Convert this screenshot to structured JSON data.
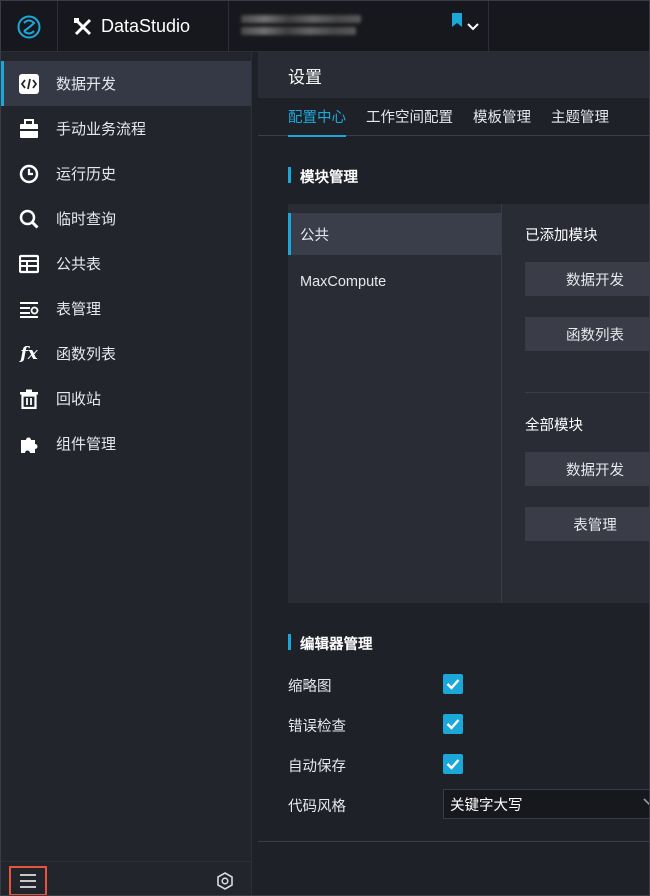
{
  "app": {
    "title": "DataStudio"
  },
  "sidebar": {
    "items": [
      {
        "label": "数据开发",
        "icon": "code-icon",
        "active": true
      },
      {
        "label": "手动业务流程",
        "icon": "briefcase-icon"
      },
      {
        "label": "运行历史",
        "icon": "clock-icon"
      },
      {
        "label": "临时查询",
        "icon": "search-icon"
      },
      {
        "label": "公共表",
        "icon": "table-icon"
      },
      {
        "label": "表管理",
        "icon": "table-manage-icon"
      },
      {
        "label": "函数列表",
        "icon": "function-icon"
      },
      {
        "label": "回收站",
        "icon": "trash-icon"
      },
      {
        "label": "组件管理",
        "icon": "puzzle-icon"
      }
    ]
  },
  "main": {
    "title": "设置",
    "tabs": [
      {
        "label": "配置中心",
        "active": true
      },
      {
        "label": "工作空间配置"
      },
      {
        "label": "模板管理"
      },
      {
        "label": "主题管理"
      }
    ],
    "module_section": {
      "title": "模块管理",
      "categories": [
        {
          "label": "公共",
          "active": true
        },
        {
          "label": "MaxCompute"
        }
      ],
      "added_title": "已添加模块",
      "added_modules": [
        "数据开发",
        "函数列表"
      ],
      "all_title": "全部模块",
      "all_modules": [
        "数据开发",
        "表管理"
      ]
    },
    "editor_section": {
      "title": "编辑器管理",
      "options": [
        {
          "label": "缩略图",
          "checked": true
        },
        {
          "label": "错误检查",
          "checked": true
        },
        {
          "label": "自动保存",
          "checked": true
        }
      ],
      "code_style_label": "代码风格",
      "code_style_value": "关键字大写"
    }
  },
  "colors": {
    "accent": "#1ba8d8",
    "highlight_border": "#e8533c"
  }
}
